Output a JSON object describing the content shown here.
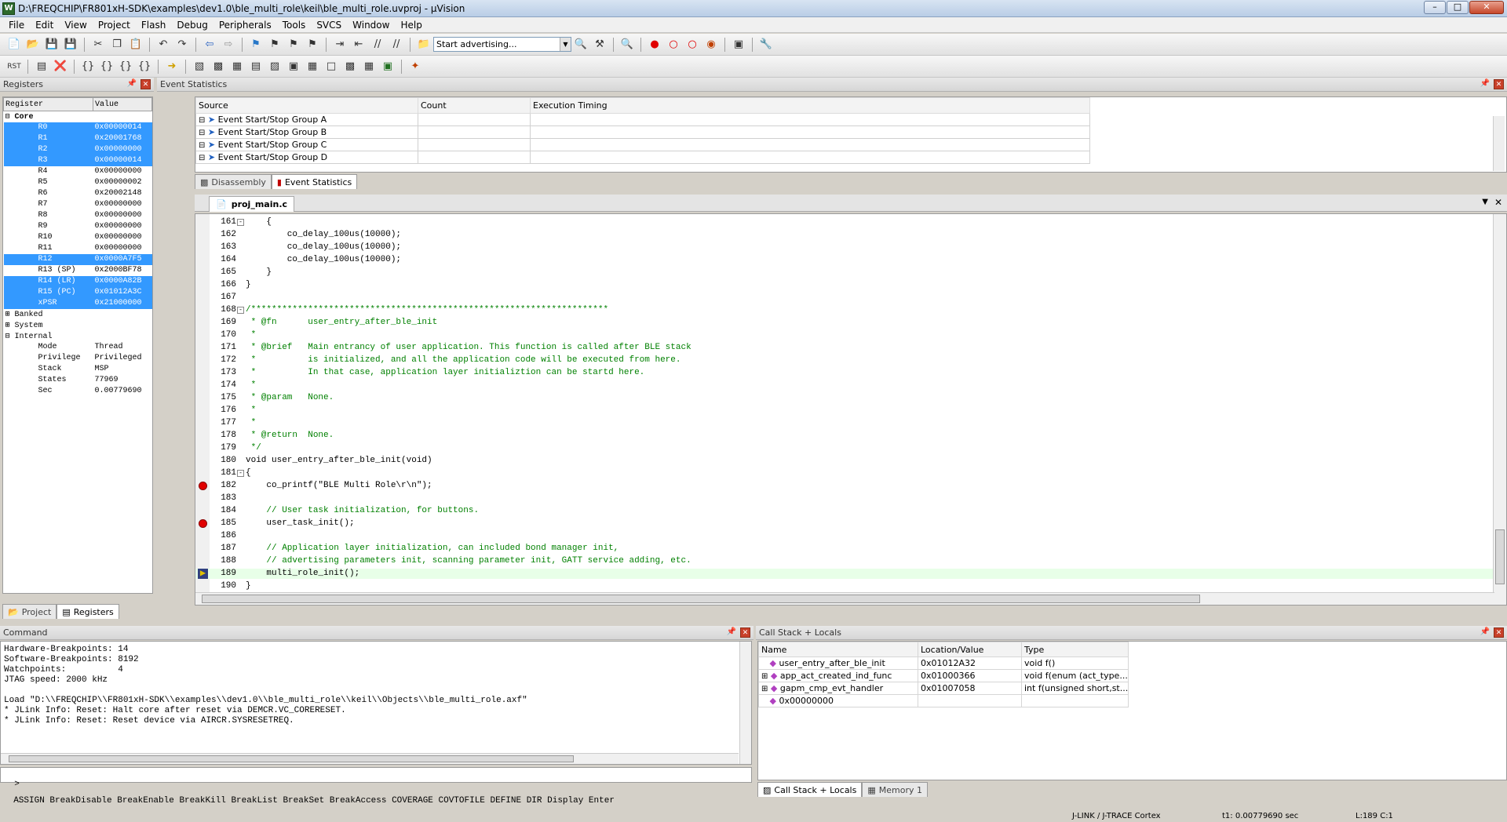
{
  "window": {
    "title": "D:\\FREQCHIP\\FR801xH-SDK\\examples\\dev1.0\\ble_multi_role\\keil\\ble_multi_role.uvproj - µVision",
    "app_icon": "W"
  },
  "menu": [
    "File",
    "Edit",
    "View",
    "Project",
    "Flash",
    "Debug",
    "Peripherals",
    "Tools",
    "SVCS",
    "Window",
    "Help"
  ],
  "toolbar": {
    "combo_value": "Start advertising..."
  },
  "registers": {
    "header": "Registers",
    "col_register": "Register",
    "col_value": "Value",
    "group_core": "Core",
    "rows": [
      {
        "name": "R0",
        "value": "0x00000014",
        "sel": true
      },
      {
        "name": "R1",
        "value": "0x20001768",
        "sel": true
      },
      {
        "name": "R2",
        "value": "0x00000000",
        "sel": true
      },
      {
        "name": "R3",
        "value": "0x00000014",
        "sel": true
      },
      {
        "name": "R4",
        "value": "0x00000000",
        "sel": false
      },
      {
        "name": "R5",
        "value": "0x00000002",
        "sel": false
      },
      {
        "name": "R6",
        "value": "0x20002148",
        "sel": false
      },
      {
        "name": "R7",
        "value": "0x00000000",
        "sel": false
      },
      {
        "name": "R8",
        "value": "0x00000000",
        "sel": false
      },
      {
        "name": "R9",
        "value": "0x00000000",
        "sel": false
      },
      {
        "name": "R10",
        "value": "0x00000000",
        "sel": false
      },
      {
        "name": "R11",
        "value": "0x00000000",
        "sel": false
      },
      {
        "name": "R12",
        "value": "0x0000A7F5",
        "sel": true
      },
      {
        "name": "R13 (SP)",
        "value": "0x2000BF78",
        "sel": false
      },
      {
        "name": "R14 (LR)",
        "value": "0x0000A82B",
        "sel": true
      },
      {
        "name": "R15 (PC)",
        "value": "0x01012A3C",
        "sel": true
      },
      {
        "name": "xPSR",
        "value": "0x21000000",
        "sel": true
      }
    ],
    "groups": [
      "Banked",
      "System",
      "Internal"
    ],
    "internal": [
      {
        "name": "Mode",
        "value": "Thread"
      },
      {
        "name": "Privilege",
        "value": "Privileged"
      },
      {
        "name": "Stack",
        "value": "MSP"
      },
      {
        "name": "States",
        "value": "77969"
      },
      {
        "name": "Sec",
        "value": "0.00779690"
      }
    ],
    "tabs": [
      "Project",
      "Registers"
    ]
  },
  "event_stats": {
    "header": "Event Statistics",
    "columns": [
      "Source",
      "Count",
      "Execution Timing"
    ],
    "rows": [
      "Event Start/Stop Group A",
      "Event Start/Stop Group B",
      "Event Start/Stop Group C",
      "Event Start/Stop Group D"
    ],
    "tabs": [
      "Disassembly",
      "Event Statistics"
    ]
  },
  "editor": {
    "file_tab": "proj_main.c",
    "lines": [
      {
        "n": "161",
        "t": "    {",
        "fold": "-"
      },
      {
        "n": "162",
        "t": "        co_delay_100us(10000);"
      },
      {
        "n": "163",
        "t": "        co_delay_100us(10000);"
      },
      {
        "n": "164",
        "t": "        co_delay_100us(10000);"
      },
      {
        "n": "165",
        "t": "    }"
      },
      {
        "n": "166",
        "t": "}"
      },
      {
        "n": "167",
        "t": ""
      },
      {
        "n": "168",
        "t": "/*********************************************************************",
        "fold": "-",
        "c": "com"
      },
      {
        "n": "169",
        "t": " * @fn      user_entry_after_ble_init",
        "c": "com"
      },
      {
        "n": "170",
        "t": " *",
        "c": "com"
      },
      {
        "n": "171",
        "t": " * @brief   Main entrancy of user application. This function is called after BLE stack",
        "c": "com"
      },
      {
        "n": "172",
        "t": " *          is initialized, and all the application code will be executed from here.",
        "c": "com"
      },
      {
        "n": "173",
        "t": " *          In that case, application layer initializtion can be startd here.",
        "c": "com"
      },
      {
        "n": "174",
        "t": " *",
        "c": "com"
      },
      {
        "n": "175",
        "t": " * @param   None.",
        "c": "com"
      },
      {
        "n": "176",
        "t": " *",
        "c": "com"
      },
      {
        "n": "177",
        "t": " *",
        "c": "com"
      },
      {
        "n": "178",
        "t": " * @return  None.",
        "c": "com"
      },
      {
        "n": "179",
        "t": " */",
        "c": "com"
      },
      {
        "n": "180",
        "t": "void user_entry_after_ble_init(void)"
      },
      {
        "n": "181",
        "t": "{",
        "fold": "-"
      },
      {
        "n": "182",
        "t": "    co_printf(\"BLE Multi Role\\r\\n\");",
        "bp": true
      },
      {
        "n": "183",
        "t": ""
      },
      {
        "n": "184",
        "t": "    // User task initialization, for buttons.",
        "c": "com"
      },
      {
        "n": "185",
        "t": "    user_task_init();",
        "bp": true
      },
      {
        "n": "186",
        "t": ""
      },
      {
        "n": "187",
        "t": "    // Application layer initialization, can included bond manager init,",
        "c": "com"
      },
      {
        "n": "188",
        "t": "    // advertising parameters init, scanning parameter init, GATT service adding, etc.",
        "c": "com"
      },
      {
        "n": "189",
        "t": "    multi_role_init();",
        "cur": true
      },
      {
        "n": "190",
        "t": "}"
      },
      {
        "n": "191",
        "t": ""
      }
    ]
  },
  "command": {
    "header": "Command",
    "lines": [
      "Hardware-Breakpoints: 14",
      "Software-Breakpoints: 8192",
      "Watchpoints:          4",
      "JTAG speed: 2000 kHz",
      "",
      "Load \"D:\\\\FREQCHIP\\\\FR801xH-SDK\\\\examples\\\\dev1.0\\\\ble_multi_role\\\\keil\\\\Objects\\\\ble_multi_role.axf\"",
      "* JLink Info: Reset: Halt core after reset via DEMCR.VC_CORERESET.",
      "* JLink Info: Reset: Reset device via AIRCR.SYSRESETREQ."
    ],
    "prompt": ">",
    "hints": "ASSIGN BreakDisable BreakEnable BreakKill BreakList BreakSet BreakAccess COVERAGE COVTOFILE DEFINE DIR Display Enter"
  },
  "callstack": {
    "header": "Call Stack + Locals",
    "columns": [
      "Name",
      "Location/Value",
      "Type"
    ],
    "rows": [
      {
        "name": "user_entry_after_ble_init",
        "loc": "0x01012A32",
        "type": "void f()",
        "exp": false
      },
      {
        "name": "app_act_created_ind_func",
        "loc": "0x01000366",
        "type": "void f(enum (act_type...",
        "exp": true
      },
      {
        "name": "gapm_cmp_evt_handler",
        "loc": "0x01007058",
        "type": "int f(unsigned short,st...",
        "exp": true
      },
      {
        "name": "0x00000000",
        "loc": "",
        "type": "",
        "exp": false
      }
    ],
    "tabs": [
      "Call Stack + Locals",
      "Memory 1"
    ]
  },
  "status": {
    "debugger": "J-LINK / J-TRACE Cortex",
    "time": "t1: 0.00779690 sec",
    "pos": "L:189 C:1"
  },
  "colors": {
    "selection": "#3399ff",
    "breakpoint": "#e00000",
    "current_line": "#e8ffe8",
    "comment": "#008000",
    "keyword": "#0000ff"
  }
}
